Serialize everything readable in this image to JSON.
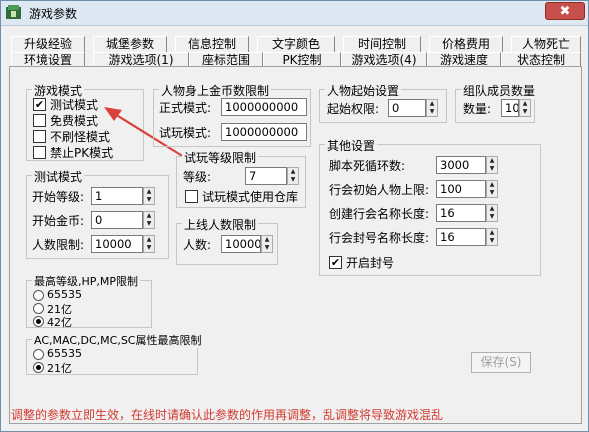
{
  "window": {
    "title": "游戏参数",
    "close_symbol": "✖"
  },
  "tabs_top": [
    "升级经验",
    "城堡参数",
    "信息控制",
    "文字颜色",
    "时间控制",
    "价格费用",
    "人物死亡"
  ],
  "tabs_bottom": [
    "环境设置",
    "游戏选项(1)",
    "座标范围",
    "PK控制",
    "游戏选项(4)",
    "游戏速度",
    "状态控制"
  ],
  "game_mode": {
    "title": "游戏模式",
    "options": [
      {
        "label": "测试模式",
        "checked": true
      },
      {
        "label": "免费模式",
        "checked": false
      },
      {
        "label": "不刷怪模式",
        "checked": false
      },
      {
        "label": "禁止PK模式",
        "checked": false
      }
    ]
  },
  "gold_limit": {
    "title": "人物身上金币数限制",
    "formal_label": "正式模式:",
    "formal_value": "1000000000",
    "trial_label": "试玩模式:",
    "trial_value": "1000000000"
  },
  "start_setting": {
    "title": "人物起始设置",
    "label": "起始权限:",
    "value": "0"
  },
  "team": {
    "title": "组队成员数量",
    "label": "数量:",
    "value": "10"
  },
  "trial_level": {
    "title": "试玩等级限制",
    "label": "等级:",
    "value": "7",
    "warehouse_label": "试玩模式使用仓库"
  },
  "online_limit": {
    "title": "上线人数限制",
    "label": "人数:",
    "value": "10000"
  },
  "test_mode": {
    "title": "测试模式",
    "level_label": "开始等级:",
    "level_value": "1",
    "gold_label": "开始金币:",
    "gold_value": "0",
    "people_label": "人数限制:",
    "people_value": "10000"
  },
  "other": {
    "title": "其他设置",
    "script_label": "脚本死循环数:",
    "script_value": "3000",
    "guild_init_label": "行会初始人物上限:",
    "guild_init_value": "100",
    "guild_name_label": "创建行会名称长度:",
    "guild_name_value": "16",
    "guild_seal_label": "行会封号名称长度:",
    "guild_seal_value": "16",
    "seal_label": "开启封号"
  },
  "max_level": {
    "title": "最高等级,HP,MP限制",
    "options": [
      "65535",
      "21亿",
      "42亿"
    ],
    "selected": 2
  },
  "attr_limit": {
    "title": "AC,MAC,DC,MC,SC属性最高限制",
    "options": [
      "65535",
      "21亿"
    ],
    "selected": 1
  },
  "save_button": "保存(S)",
  "bottom_note": "调整的参数立即生效，在线时请确认此参数的作用再调整，乱调整将导致游戏混乱",
  "colors": {
    "note": "#d13a2f",
    "arrow": "#d9413a"
  }
}
